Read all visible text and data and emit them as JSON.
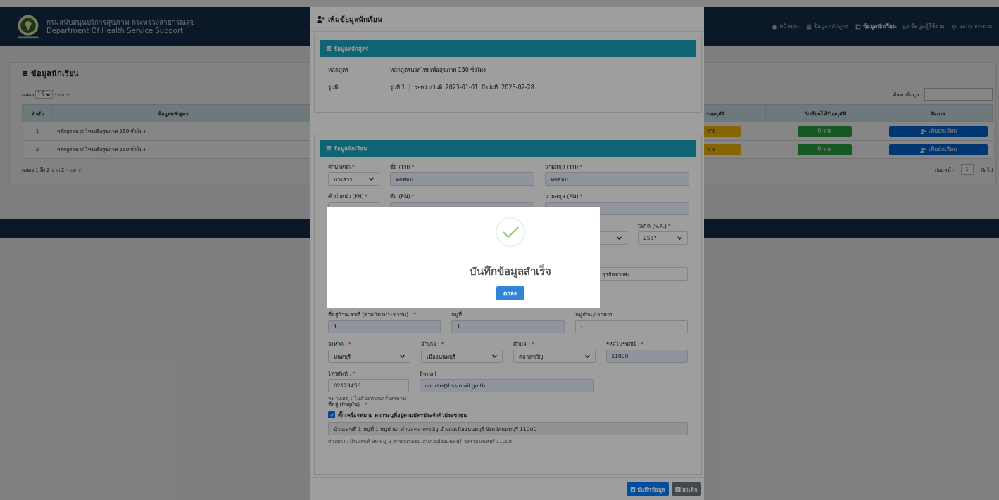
{
  "header": {
    "org_th": "กรมสนับสนุนบริการสุขภาพ กระทรวงสาธารณสุข",
    "org_en": "Department Of Health Service Support"
  },
  "nav": [
    {
      "label": "หน้าแรก",
      "selected": false
    },
    {
      "label": "ข้อมูลหลักสูตร",
      "selected": false
    },
    {
      "label": "ข้อมูลนักเรียน",
      "selected": true
    },
    {
      "label": "ข้อมูลผู้ใช้งาน",
      "selected": false
    },
    {
      "label": "ออกจากระบบ",
      "selected": false
    }
  ],
  "student_list": {
    "title": "ข้อมูลนักเรียน",
    "show_prefix": "แสดง",
    "page_size": "15",
    "show_suffix": "รายการ",
    "search_label": "ค้นหาข้อมูล :",
    "columns": [
      "ลำดับ",
      "ข้อมูลหลักสูตร",
      "รออนุมัติ",
      "นักเรียนได้รับอนุมัติ",
      "จัดการ"
    ],
    "rows": [
      {
        "no": "1",
        "course": "หลักสูตรนวดไทยเพื่อสุขภาพ 150 ชั่วโมง",
        "pending": "ราย",
        "approved": "0 ราย",
        "action": "เพิ่มนักเรียน"
      },
      {
        "no": "2",
        "course": "หลักสูตรนวดไทยเพื่อสุขภาพ 150 ชั่วโมง",
        "pending": "ราย",
        "approved": "0 ราย",
        "action": "เพิ่มนักเรียน"
      }
    ],
    "summary": "แสดง 1 ถึง 2 จาก 2 รายการ",
    "pagination": {
      "prev": "ก่อนหน้า",
      "pages": [
        "1"
      ],
      "next": "ถัดไป"
    }
  },
  "modal": {
    "title": "เพิ่มข้อมูลนักเรียน",
    "course_section": {
      "title": "ข้อมูลหลักสูตร",
      "rows": [
        {
          "label": "หลักสูตร",
          "value": "หลักสูตรนวดไทยเพื่อสุขภาพ 150 ชั่วโมง"
        },
        {
          "label": "รุ่นที่",
          "value": "รุ่นที่ 1  |  ระหว่างวันที่  2023-01-01  ถึงวันที่  2023-02-28"
        }
      ]
    },
    "student_section": {
      "title": "ข้อมูลนักเรียน",
      "name_rows": [
        [
          {
            "label": "คำนำหน้า",
            "required_mark": "*",
            "kind": "select",
            "value": "นางสาว"
          },
          {
            "label": "ชื่อ (TH)",
            "required_mark": "*",
            "kind": "input",
            "value": "ทดสอบ",
            "autofilled": true
          },
          {
            "label": "นามสกุล (TH)",
            "required_mark": "*",
            "kind": "input",
            "value": "ทดสอบ",
            "autofilled": true
          }
        ],
        [
          {
            "label": "คำนำหน้า (EN)",
            "required_mark": "*",
            "kind": "select"
          },
          {
            "label": "ชื่อ (EN)",
            "required_mark": "*",
            "kind": "input",
            "autofilled": true
          },
          {
            "label": "นามสกุล (EN)",
            "required_mark": "*",
            "kind": "input",
            "autofilled": true
          }
        ]
      ],
      "birth_year": {
        "label": "ปีเกิด (พ.ศ.)",
        "required_mark": "*",
        "value": "2537"
      },
      "occupation": {
        "value": "ธุรกิจขายส่ง"
      },
      "address_rows": [
        [
          {
            "label": "ที่อยู่บ้านเลขที่ (ตามบัตรประชาชน) :",
            "required_mark": "*",
            "kind": "input",
            "value": "1",
            "autofilled": true
          },
          {
            "label": "หมู่ที่ :",
            "kind": "input",
            "value": "1",
            "autofilled": true
          },
          {
            "label": "หมู่บ้าน / อาคาร :",
            "kind": "input",
            "value": "-",
            "autofilled": false
          }
        ],
        [
          {
            "label": "จังหวัด :",
            "required_mark": "*",
            "kind": "select",
            "value": "นนทบุรี"
          },
          {
            "label": "อำเภอ :",
            "required_mark": "*",
            "kind": "select",
            "value": "เมืองนนทบุรี"
          },
          {
            "label": "ตำบล :",
            "required_mark": "*",
            "kind": "select",
            "value": "ตลาดขวัญ"
          },
          {
            "label": "รหัสไปรษณีย์ :",
            "required_mark": "*",
            "kind": "input",
            "value": "11000",
            "autofilled": true
          }
        ],
        [
          {
            "label": "โทรศัพท์ :",
            "required_mark": "*",
            "kind": "input",
            "value": "02123456",
            "autofilled": false,
            "hint": "หมายเหตุ : ไม่ต้องกรอกเครื่องหมาย -"
          },
          {
            "label": "E-mail :",
            "kind": "input",
            "value": "course@hss.mail.go.th",
            "autofilled": true
          }
        ]
      ],
      "current_address": {
        "label": "ที่อยู่ (ปัจจุบัน) :",
        "required_mark": "*",
        "checkbox_label": "ติ๊กเครื่องหมาย หากระบุที่อยู่ตามบัตรประจำตัวประชาชน",
        "checked": true,
        "value": "บ้านเลขที่ 1 หมู่ที่ 1 หมู่บ้าน- ตำบลตลาดขวัญ อำเภอเมืองนนทบุรี จังหวัดนนทบุรี 11000",
        "hint": "ตัวอย่าง : บ้านเลขที่ 99 หมู่ 9 ตำบลบางเขน อำเภอเมืองนนทบุรี จังหวัดนนทบุรี 11000"
      }
    },
    "buttons": [
      {
        "label": "บันทึกข้อมูล",
        "kind": "primary"
      },
      {
        "label": "ยกเลิก",
        "kind": "secondary"
      }
    ]
  },
  "dialog": {
    "title": "บันทึกข้อมูลสำเร็จ",
    "button": "ตกลง"
  }
}
